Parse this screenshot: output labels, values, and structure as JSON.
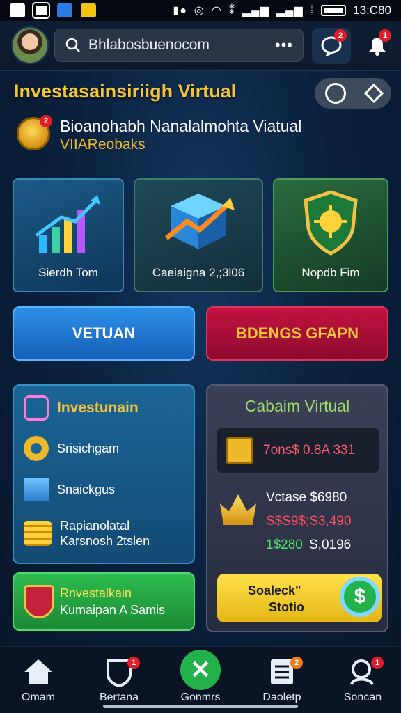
{
  "status_bar": {
    "time": "13:C80"
  },
  "header": {
    "search_text": "Bhlabosbuenocom",
    "search_more": "•••",
    "chat_badge": "2",
    "bell_badge": "1"
  },
  "title": "Investasainsiriigh Virtual",
  "subtitle": {
    "badge": "2",
    "line1": "Bioanohabh Nanalalmohta Viatual",
    "line2": "VIIAReobaks"
  },
  "feature_cards": [
    {
      "label": "Sierdh Tom"
    },
    {
      "label": "Caeiaigna 2,;3l06"
    },
    {
      "label": "Nopdb Fim"
    }
  ],
  "buttons": {
    "primary": "VETUAN",
    "secondary": "BDENGS GFAPN"
  },
  "left_panel": {
    "title": "Investunain",
    "items": [
      {
        "label": "Srisichgam"
      },
      {
        "label": "Snaickgus"
      },
      {
        "label": "Rapianolatal",
        "label2": "Karsnosh 2tslen"
      }
    ]
  },
  "right_panel": {
    "title": "Cabaim Virtual",
    "box_value": "7ons$ 0.8A 331",
    "line1": "Vctase $6980",
    "line2": "S$S9$;S3,490",
    "line3_a": "1$280",
    "line3_b": "S,0196",
    "yellow_btn_line1": "Soaleck\"",
    "yellow_btn_line2": "Stotio"
  },
  "green_button": {
    "line1": "Rnvestalkain",
    "line2": "Kumaipan A Samis"
  },
  "bottom_nav": [
    {
      "label": "Omam"
    },
    {
      "label": "Bertana",
      "badge": "1"
    },
    {
      "label": "Gonmrs"
    },
    {
      "label": "Daoletp",
      "badge": "2"
    },
    {
      "label": "Soncan",
      "badge": "1"
    }
  ],
  "colors": {
    "accent_gold": "#f2c53a",
    "primary_blue": "#2c8fe8",
    "danger_red": "#c21240",
    "success_green": "#2dbb4e"
  }
}
